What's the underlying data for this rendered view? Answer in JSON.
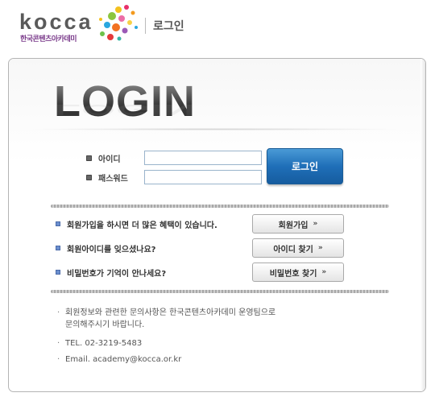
{
  "header": {
    "logo_text": "kocca",
    "logo_subtext": "한국콘텐츠아카데미",
    "title": "로그인"
  },
  "main": {
    "heading": "LOGIN",
    "form": {
      "id_label": "아이디",
      "password_label": "패스워드",
      "id_value": "",
      "password_value": "",
      "login_button": "로그인"
    },
    "links": [
      {
        "text": "회원가입을 하시면 더 많은 혜택이 있습니다.",
        "button": "회원가입"
      },
      {
        "text": "회원아이디를 잊으셨나요?",
        "button": "아이디 찾기"
      },
      {
        "text": "비밀번호가 기억이 안나세요?",
        "button": "비밀번호 찾기"
      }
    ],
    "info": {
      "notice_line1": "회원정보와 관련한 문의사항은 한국콘텐츠아카데미 운영팀으로",
      "notice_line2": "문의해주시기 바랍니다.",
      "tel": "TEL. 02-3219-5483",
      "email": "Email. academy@kocca.or.kr"
    }
  },
  "colors": {
    "accent_blue": "#1f6fb8",
    "bullet_blue": "#6b8fcf",
    "logo_purple": "#7a3a8a"
  }
}
